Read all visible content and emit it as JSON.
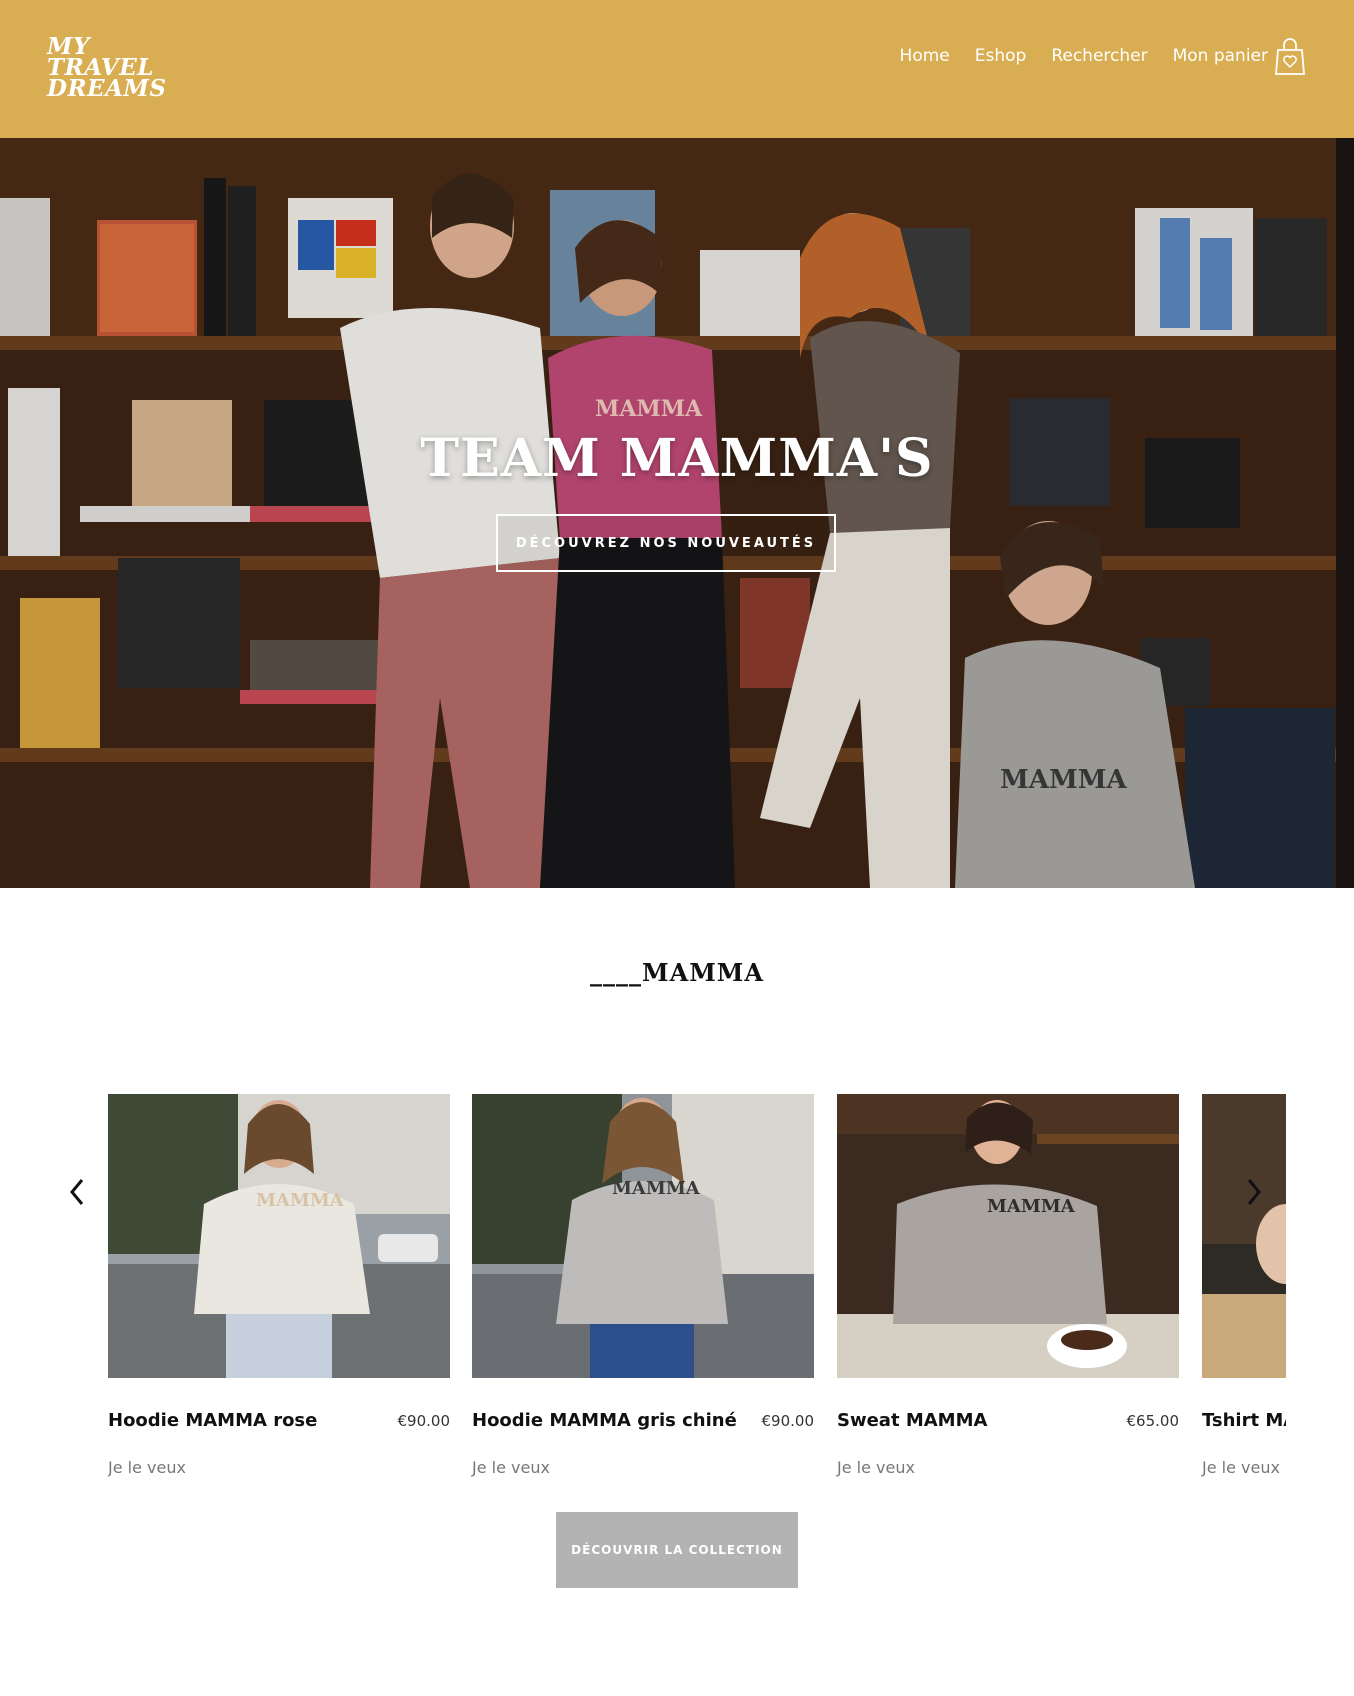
{
  "header": {
    "logo_lines": [
      "MY",
      "TRAVEL",
      "DREAMS"
    ],
    "nav": [
      {
        "label": "Home"
      },
      {
        "label": "Eshop"
      },
      {
        "label": "Rechercher"
      },
      {
        "label": "Mon panier"
      }
    ],
    "cart_icon": "shopping-bag-heart-icon",
    "background_color": "#d9ae52"
  },
  "hero": {
    "title": "TEAM MAMMA'S",
    "button_label": "DÉCOUVREZ NOS NOUVEAUTÉS"
  },
  "section": {
    "title": "____MAMMA"
  },
  "products": [
    {
      "name": "Hoodie MAMMA rose",
      "price": "€90.00",
      "cta": "Je le veux"
    },
    {
      "name": "Hoodie MAMMA gris chiné",
      "price": "€90.00",
      "cta": "Je le veux"
    },
    {
      "name": "Sweat MAMMA",
      "price": "€65.00",
      "cta": "Je le veux"
    },
    {
      "name": "Tshirt MAMMA",
      "price": "",
      "cta": "Je le veux"
    }
  ],
  "carousel": {
    "prev_icon": "chevron-left-icon",
    "next_icon": "chevron-right-icon"
  },
  "collection_button_label": "DÉCOUVRIR LA COLLECTION"
}
